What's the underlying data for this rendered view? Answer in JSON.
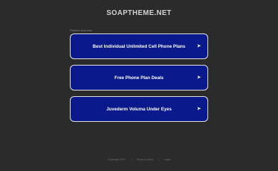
{
  "site": {
    "title": "SOAPTHEME.NET"
  },
  "related": {
    "label": "Related searches",
    "items": [
      {
        "label": "Best Individual Unlimited Cell Phone Plans",
        "arrow": "➤"
      },
      {
        "label": "Free Phone Plan Deals",
        "arrow": "➤"
      },
      {
        "label": "Juvederm Voluma Under Eyes",
        "arrow": "➤"
      }
    ]
  },
  "footer": {
    "copyright": "Copyright 2024",
    "sep1": "|",
    "privacy": "Privacy policy",
    "sep2": "|",
    "legal": "Legal"
  },
  "colors": {
    "background": "#2b2b2b",
    "link_box": "#0a1a8c",
    "link_border": "#e6e6e6"
  }
}
